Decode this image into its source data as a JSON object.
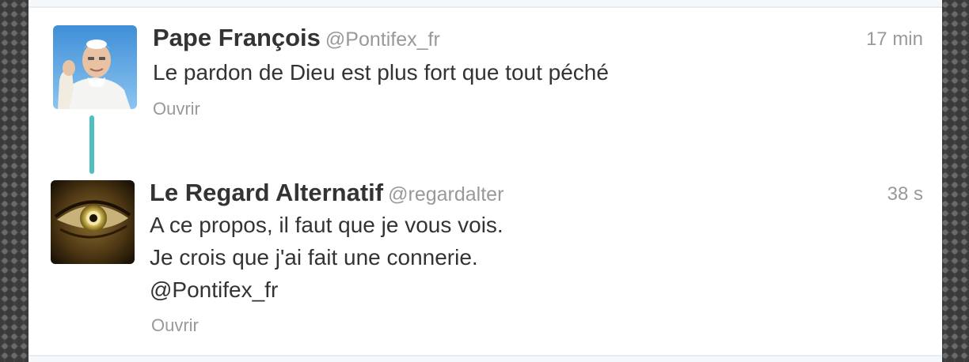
{
  "tweets": [
    {
      "name": "Pape François",
      "handle": "@Pontifex_fr",
      "time": "17 min",
      "lines": [
        "Le pardon de Dieu est plus fort que tout péché"
      ],
      "open_label": "Ouvrir",
      "avatar_icon": "pope-avatar"
    },
    {
      "name": "Le Regard Alternatif",
      "handle": "@regardalter",
      "time": "38 s",
      "lines": [
        "A ce propos, il faut que je vous vois.",
        "Je crois que j'ai fait une connerie.",
        "@Pontifex_fr"
      ],
      "open_label": "Ouvrir",
      "avatar_icon": "eye-avatar"
    }
  ],
  "colors": {
    "thread_line": "#4fbfc0",
    "name_text": "#333333",
    "meta_text": "#999999",
    "background_texture": "#4a4a4a"
  }
}
